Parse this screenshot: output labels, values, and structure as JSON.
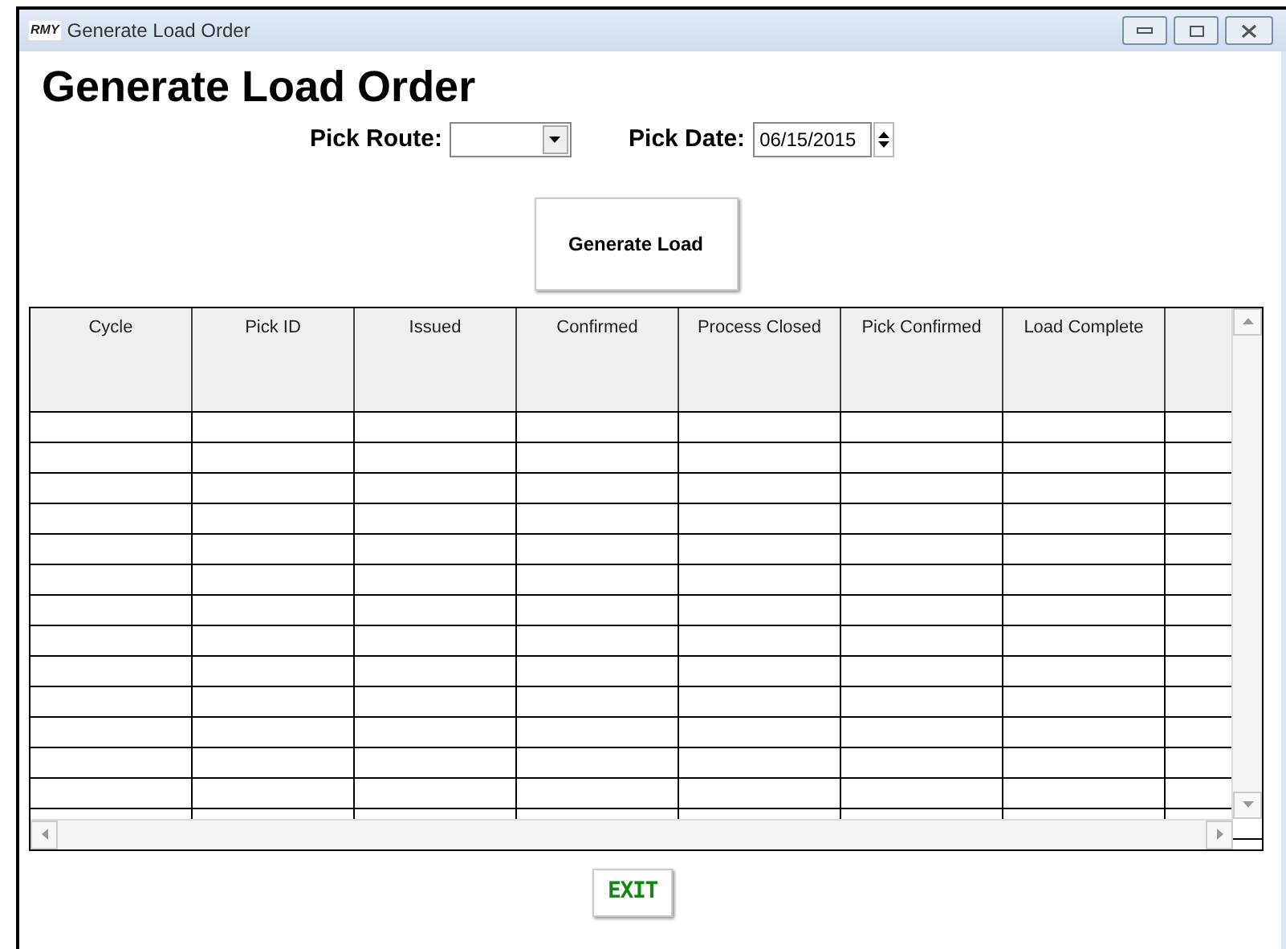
{
  "window": {
    "title": "Generate Load Order",
    "logo": "RMY"
  },
  "heading": "Generate Load Order",
  "pick_route": {
    "label": "Pick Route:"
  },
  "pick_date": {
    "label": "Pick Date:",
    "value": "06/15/2015"
  },
  "generate_button": "Generate Load",
  "table": {
    "columns": [
      "Cycle",
      "Pick ID",
      "Issued",
      "Confirmed",
      "Process Closed",
      "Pick Confirmed",
      "Load Complete"
    ]
  },
  "exit_button": "EXIT"
}
